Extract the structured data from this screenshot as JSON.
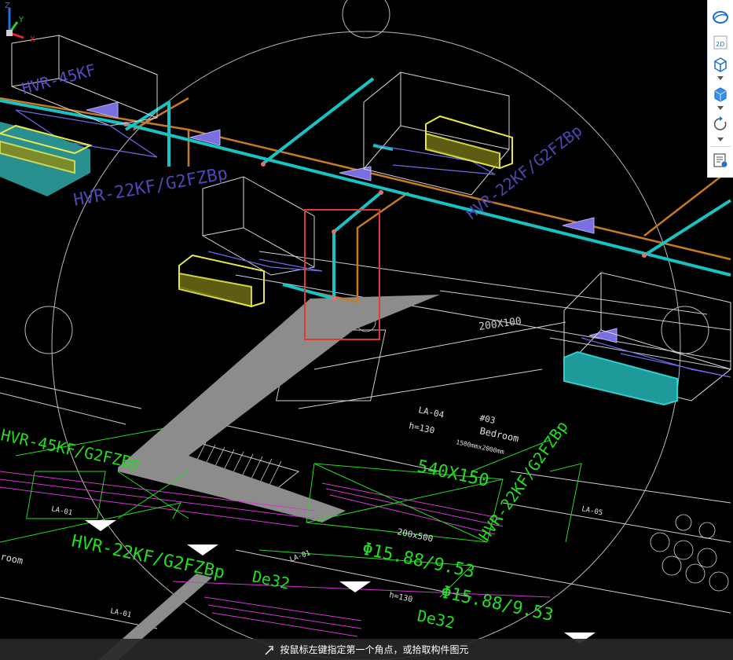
{
  "viewport": {
    "labels": {
      "pipe_top_left": "HVR-45KF",
      "pipe_mid_left": "HVR-22KF/G2FZBp",
      "pipe_right": "HVR-22KF/G2FZBp",
      "room_code": "LA-04",
      "room_height": "h=130",
      "room_name": "Bedroom",
      "room_no": "#03",
      "room_size": "1500mmx2000mm",
      "duct_size_1": "200X100",
      "duct_size_2": "540X150",
      "duct_size_3": "200x500",
      "pipe_green_1": "HVR-45KF/G2FZBp",
      "pipe_green_2": "HVR-22KF/G2FZBp",
      "pipe_green_3": "HVR-22KF/G2FZBp",
      "pipe_diam_1": "Φ15.88/9.53",
      "pipe_diam_2": "Φ15.88/9.53",
      "drain_1": "De32",
      "drain_2": "De32",
      "room_label_left": "room",
      "code_small_1": "LA-01",
      "code_small_2": "LA-01",
      "code_small_3": "LA-01",
      "code_small_4": "LA-05",
      "h_label": "h=130"
    }
  },
  "toolbar": {
    "btn_2d": "2D"
  },
  "status": {
    "prompt": "按鼠标左键指定第一个角点，或拾取构件图元"
  },
  "axes": {
    "x": "X",
    "y": "Y",
    "z": "Z"
  },
  "colors": {
    "pipe_cyan": "#19c3c3",
    "pipe_orange": "#c87a1e",
    "unit_yellow": "#e8e84a",
    "green_text": "#22dd22",
    "magenta": "#d535d5",
    "selection_red": "#e03a2a",
    "floor_gray": "#8c8c8c"
  }
}
